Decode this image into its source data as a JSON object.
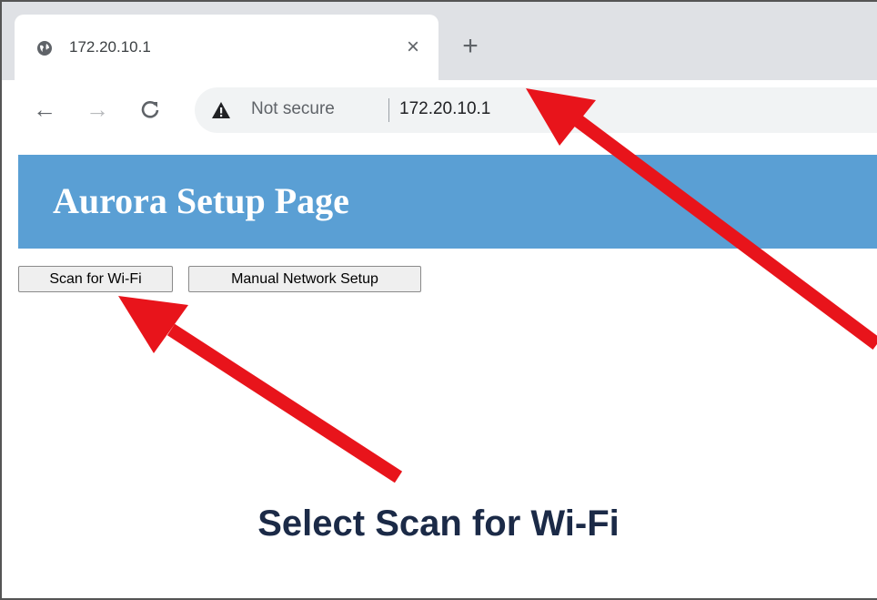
{
  "browser": {
    "tab": {
      "title": "172.20.10.1",
      "icon": "globe-icon",
      "close_icon": "×"
    },
    "new_tab_icon": "+",
    "toolbar": {
      "back_icon": "←",
      "forward_icon": "→",
      "reload_icon": "C",
      "security_label": "Not secure",
      "url": "172.20.10.1"
    }
  },
  "page": {
    "header_title": "Aurora Setup Page",
    "header_color": "#5a9fd4",
    "buttons": {
      "scan": "Scan for Wi-Fi",
      "manual": "Manual Network Setup"
    }
  },
  "annotation": {
    "caption": "Select Scan for Wi-Fi",
    "arrow_color": "#e8141b",
    "caption_color": "#1b2a47"
  }
}
